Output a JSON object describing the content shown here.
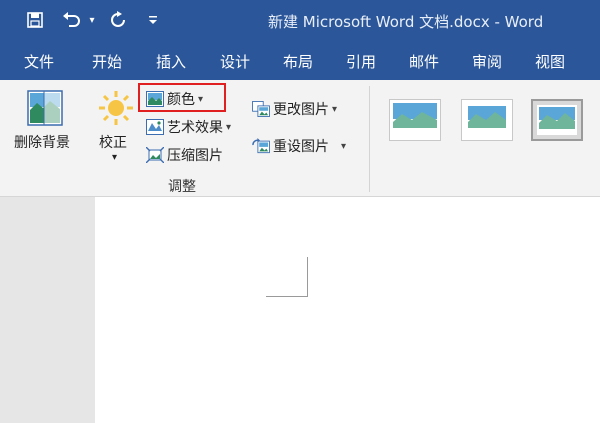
{
  "window": {
    "title": "新建 Microsoft Word 文档.docx  -  Word"
  },
  "qat": {
    "save_icon": "save-icon",
    "undo_icon": "undo-icon",
    "dropdown_icon": "caret-down-icon",
    "redo_icon": "redo-icon",
    "customize_icon": "customize-qat-icon"
  },
  "tabs": [
    {
      "label": "文件"
    },
    {
      "label": "开始"
    },
    {
      "label": "插入"
    },
    {
      "label": "设计"
    },
    {
      "label": "布局"
    },
    {
      "label": "引用"
    },
    {
      "label": "邮件"
    },
    {
      "label": "审阅"
    },
    {
      "label": "视图"
    }
  ],
  "ribbon": {
    "remove_bg": "删除背景",
    "corrections": "校正",
    "color": "颜色",
    "artistic": "艺术效果",
    "compress": "压缩图片",
    "change_pic": "更改图片",
    "reset_pic": "重设图片",
    "group_label": "调整"
  },
  "colors": {
    "accent": "#2b579a",
    "highlight_border": "#e02020",
    "ribbon_bg": "#f3f3f3"
  }
}
